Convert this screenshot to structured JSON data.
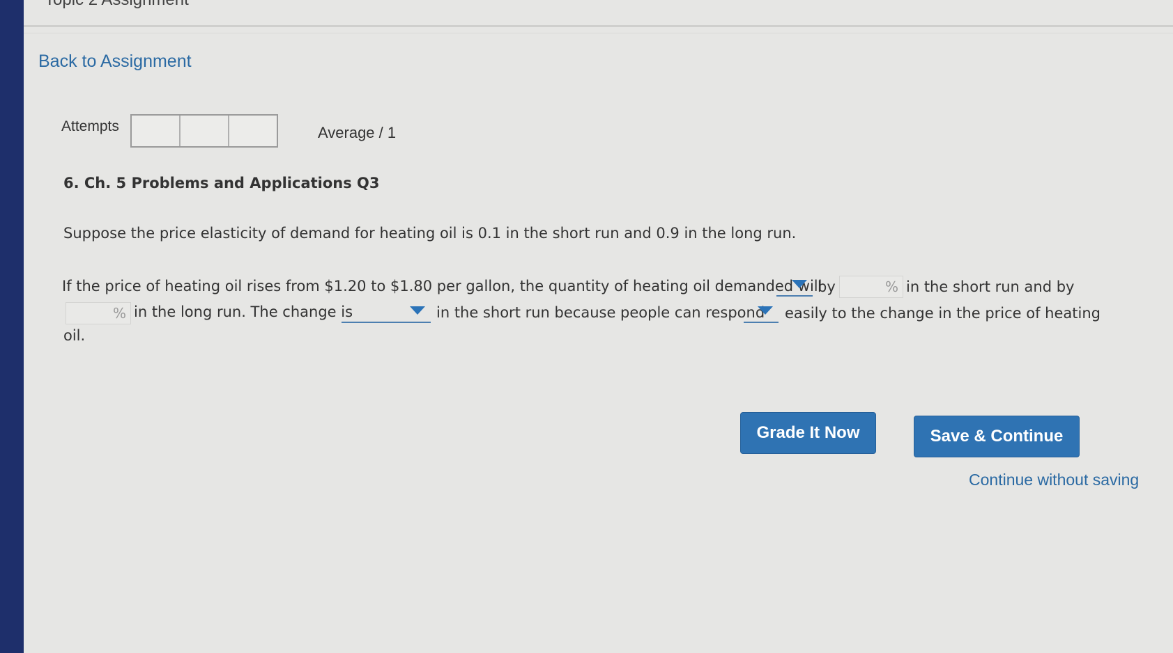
{
  "header": {
    "title_fragment": "Topic 2 Assignment"
  },
  "nav": {
    "back_label": "Back to Assignment"
  },
  "attempts": {
    "label": "Attempts",
    "box_count": 3,
    "average_text": "Average / 1"
  },
  "question": {
    "title": "6. Ch. 5 Problems and Applications Q3",
    "intro": "Suppose the price elasticity of demand for heating oil is 0.1 in the short run and 0.9 in the long run.",
    "line1_part1": "If the price of heating oil rises from $1.20 to $1.80 per gallon, the quantity of heating oil demanded will",
    "line1_part2": "by",
    "line1_part3": "in the short run and by",
    "line2_part1": "in the long run. The change is",
    "line2_part2": "in the short run because people can respond",
    "line2_part3": "easily to the change in the price of heating",
    "line3": "oil.",
    "percent_symbol": "%",
    "short_run_pct_value": "",
    "long_run_pct_value": "",
    "dropdown_change_value": "",
    "dropdown_size_value": "",
    "dropdown_ease_value": ""
  },
  "actions": {
    "grade_label": "Grade It Now",
    "save_label": "Save & Continue",
    "continue_label": "Continue without saving"
  },
  "colors": {
    "link": "#2b6aa3",
    "button": "#2f73b3",
    "sidebar": "#1e2f6b",
    "background": "#e6e6e4"
  }
}
